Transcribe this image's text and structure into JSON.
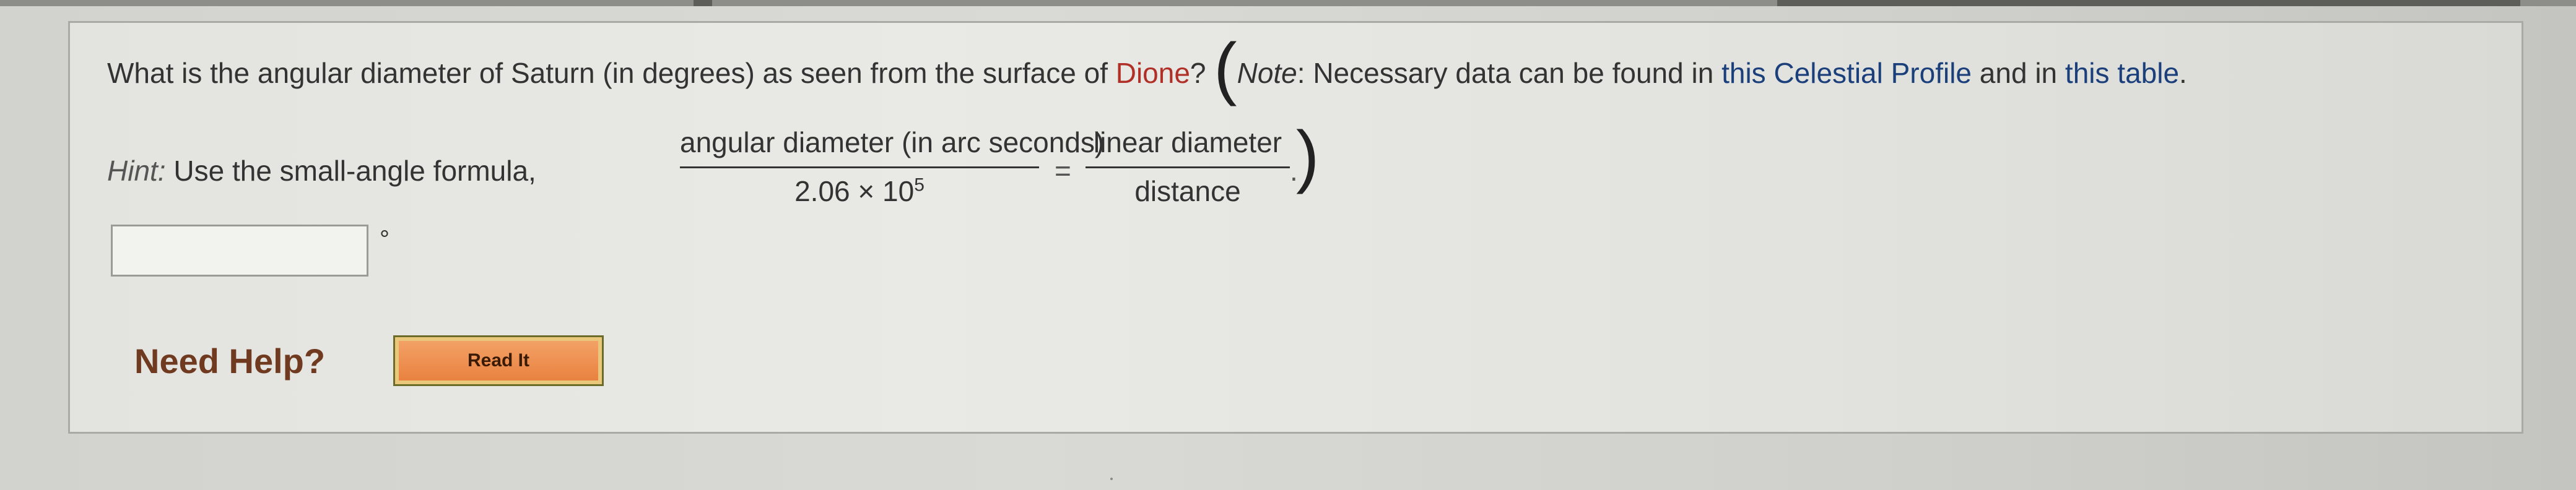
{
  "question": {
    "prefix": "What is the angular diameter of Saturn (in degrees) as seen from the surface of ",
    "moon": "Dione",
    "suffix": "?",
    "open_paren": "(",
    "note_label": "Note",
    "note_sep": ": ",
    "note_text_a": "Necessary data can be found in ",
    "note_link_1": "this Celestial Profile",
    "note_text_b": " and in ",
    "note_link_2": "this table",
    "note_end": "."
  },
  "hint": {
    "label": "Hint:",
    "text": " Use the small-angle formula,",
    "left_num": "angular diameter (in arc seconds)",
    "left_den_base": "2.06 × 10",
    "left_den_exp": "5",
    "equals": "=",
    "right_num": "linear diameter",
    "right_den": "distance",
    "period": ".",
    "close_paren": ")"
  },
  "answer": {
    "value": "",
    "unit": "°"
  },
  "help": {
    "label": "Need Help?",
    "read_it": "Read It"
  },
  "colors": {
    "moon_highlight": "#b03028",
    "link_blue": "#1a3f7a",
    "help_label": "#6f3a1f",
    "button_fill": "#e87f3c"
  }
}
